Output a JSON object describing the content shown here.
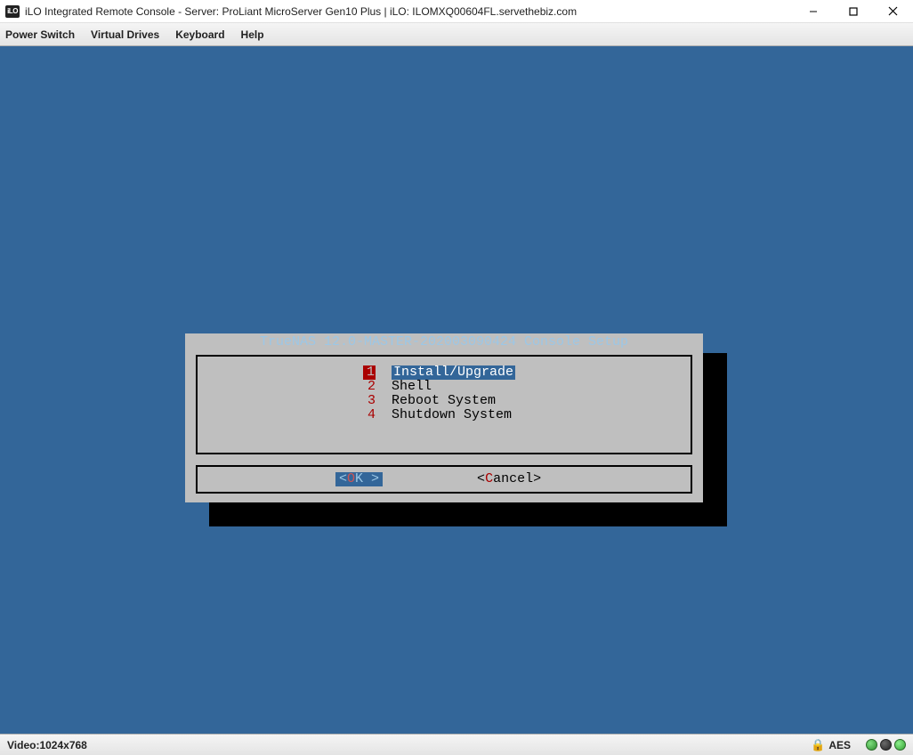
{
  "window": {
    "icon_text": "iLO",
    "title": "iLO Integrated Remote Console - Server: ProLiant MicroServer Gen10 Plus | iLO: ILOMXQ00604FL.servethebiz.com"
  },
  "menubar": {
    "items": [
      "Power Switch",
      "Virtual Drives",
      "Keyboard",
      "Help"
    ]
  },
  "console": {
    "dialog_title": "TrueNAS 12.0-MASTER-202003090424 Console Setup",
    "menu": [
      {
        "num": "1",
        "label": "Install/Upgrade",
        "selected": true
      },
      {
        "num": "2",
        "label": "Shell",
        "selected": false
      },
      {
        "num": "3",
        "label": "Reboot System",
        "selected": false
      },
      {
        "num": "4",
        "label": "Shutdown System",
        "selected": false
      }
    ],
    "ok": {
      "pre": "<  ",
      "hot": "O",
      "rest": "K  >"
    },
    "cancel": {
      "pre": "<",
      "hot": "C",
      "rest": "ancel>"
    }
  },
  "statusbar": {
    "video": "Video:1024x768",
    "enc": "AES"
  }
}
